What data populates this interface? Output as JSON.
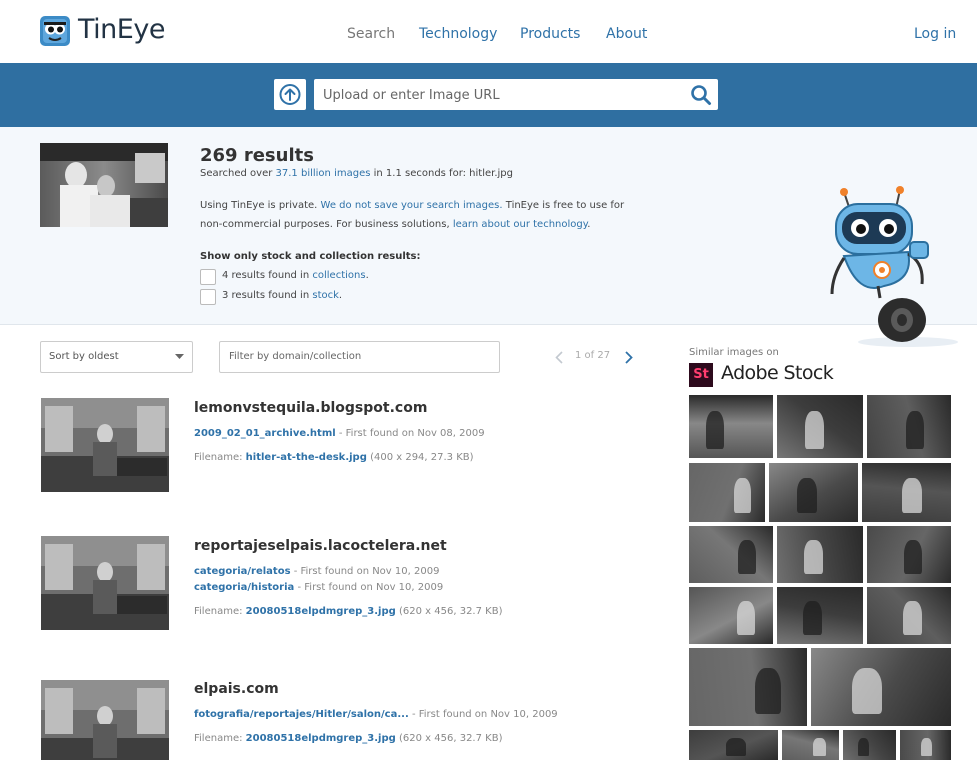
{
  "header": {
    "logo_text": "TinEye",
    "nav": [
      "Search",
      "Technology",
      "Products",
      "About"
    ],
    "login": "Log in"
  },
  "search": {
    "placeholder": "Upload or enter Image URL"
  },
  "summary": {
    "count": "269 results",
    "searched_prefix": "Searched over",
    "searched_link": "37.1 billion images",
    "searched_suffix": "in 1.1 seconds for: hitler.jpg",
    "privacy_prefix": "Using TinEye is private.",
    "privacy_link": "We do not save your search images.",
    "privacy_suffix": "TinEye is free to use for",
    "privacy_line2_prefix": "non-commercial purposes. For business solutions,",
    "privacy_line2_link": "learn about our technology",
    "privacy_line2_suffix": ".",
    "filter_heading": "Show only stock and collection results:",
    "filter_collections_prefix": "4 results found in",
    "filter_collections_link": "collections",
    "filter_stock_prefix": "3 results found in",
    "filter_stock_link": "stock",
    "period": "."
  },
  "controls": {
    "sort_label": "Sort by oldest",
    "filter_placeholder": "Filter by domain/collection",
    "pager": "1 of 27"
  },
  "results": [
    {
      "domain": "lemonvstequila.blogspot.com",
      "links": [
        {
          "text": "2009_02_01_archive.html",
          "found": "- First found on Nov 08, 2009"
        }
      ],
      "filename_label": "Filename:",
      "filename": "hitler-at-the-desk.jpg",
      "filesize": "(400 x 294, 27.3 KB)"
    },
    {
      "domain": "reportajeselpais.lacoctelera.net",
      "links": [
        {
          "text": "categoria/relatos",
          "found": "- First found on Nov 10, 2009"
        },
        {
          "text": "categoria/historia",
          "found": "- First found on Nov 10, 2009"
        }
      ],
      "filename_label": "Filename:",
      "filename": "20080518elpdmgrep_3.jpg",
      "filesize": "(620 x 456, 32.7 KB)"
    },
    {
      "domain": "elpais.com",
      "links": [
        {
          "text": "fotografia/reportajes/Hitler/salon/ca...",
          "found": "- First found on Nov 10, 2009"
        }
      ],
      "filename_label": "Filename:",
      "filename": "20080518elpdmgrep_3.jpg",
      "filesize": "(620 x 456, 32.7 KB)"
    }
  ],
  "sidebar": {
    "label": "Similar images on",
    "brand_mark": "St",
    "brand_name": "Adobe Stock"
  },
  "colors": {
    "accent": "#2f72a8",
    "band": "#2f6fa1",
    "summary_bg": "#f4f8fc"
  },
  "icons": [
    "upload-icon",
    "search-icon",
    "chevron-down-icon",
    "chevron-left-icon",
    "chevron-right-icon"
  ]
}
